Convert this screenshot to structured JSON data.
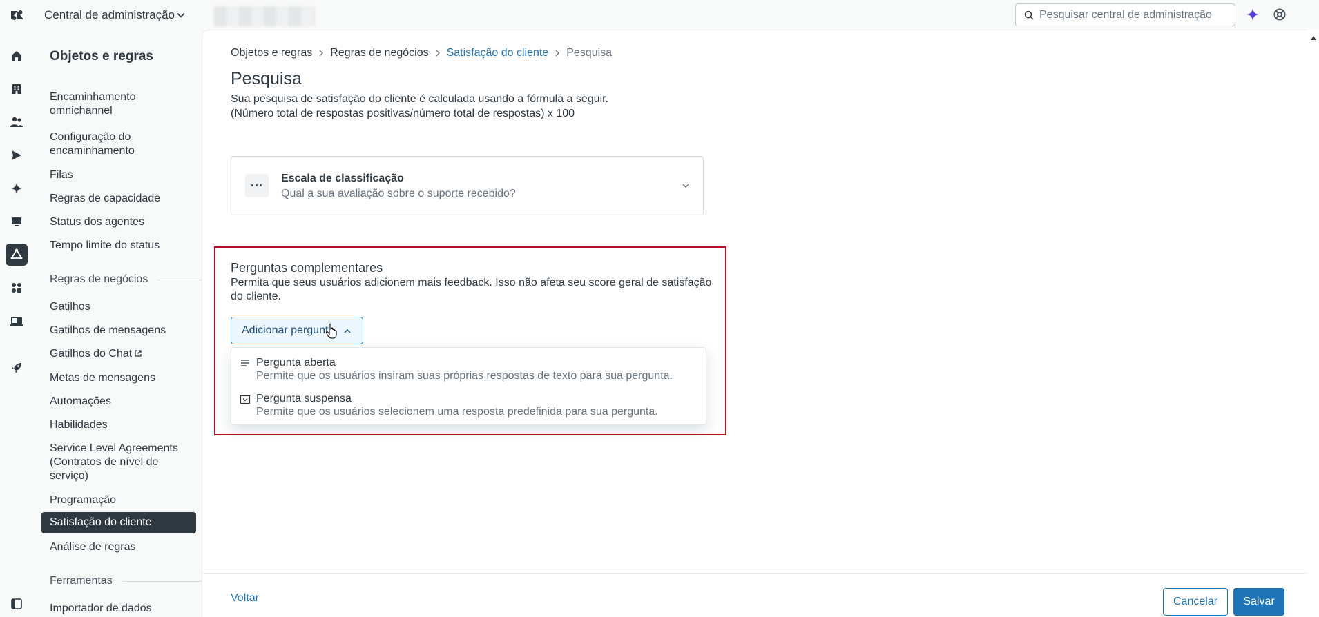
{
  "topbar": {
    "app_title": "Central de administração",
    "search_placeholder": "Pesquisar central de administração"
  },
  "sidebar": {
    "title": "Objetos e regras",
    "group1": [
      "Encaminhamento omnichannel",
      "Configuração do encaminhamento",
      "Filas",
      "Regras de capacidade",
      "Status dos agentes",
      "Tempo limite do status"
    ],
    "section_business": "Regras de negócios",
    "group2": [
      "Gatilhos",
      "Gatilhos de mensagens",
      "Gatilhos do Chat",
      "Metas de mensagens",
      "Automações",
      "Habilidades",
      "Service Level Agreements (Contratos de nível de serviço)",
      "Programação",
      "Satisfação do cliente",
      "Análise de regras"
    ],
    "section_tools": "Ferramentas",
    "group3": [
      "Importador de dados"
    ]
  },
  "breadcrumb": [
    "Objetos e regras",
    "Regras de negócios",
    "Satisfação do cliente",
    "Pesquisa"
  ],
  "page": {
    "title": "Pesquisa",
    "description_line1": "Sua pesquisa de satisfação do cliente é calculada usando a fórmula a seguir.",
    "description_line2": "(Número total de respostas positivas/número total de respostas) x 100"
  },
  "rating_scale": {
    "icon_text": "···",
    "title": "Escala de classificação",
    "subtitle": "Qual a sua avaliação sobre o suporte recebido?"
  },
  "complementary": {
    "title": "Perguntas complementares",
    "description": "Permita que seus usuários adicionem mais feedback. Isso não afeta seu score geral de satisfação do cliente.",
    "add_button": "Adicionar pergunta",
    "options": [
      {
        "icon": "lines-icon",
        "title": "Pergunta aberta",
        "subtitle": "Permite que os usuários insiram suas próprias respostas de texto para sua pergunta."
      },
      {
        "icon": "dropdown-box-icon",
        "title": "Pergunta suspensa",
        "subtitle": "Permite que os usuários selecionem uma resposta predefinida para sua pergunta."
      }
    ]
  },
  "footer": {
    "back": "Voltar",
    "cancel": "Cancelar",
    "save": "Salvar"
  },
  "colors": {
    "accent": "#1f73b7",
    "highlight_border": "#b4101d",
    "selected_bg": "#2f3941"
  }
}
